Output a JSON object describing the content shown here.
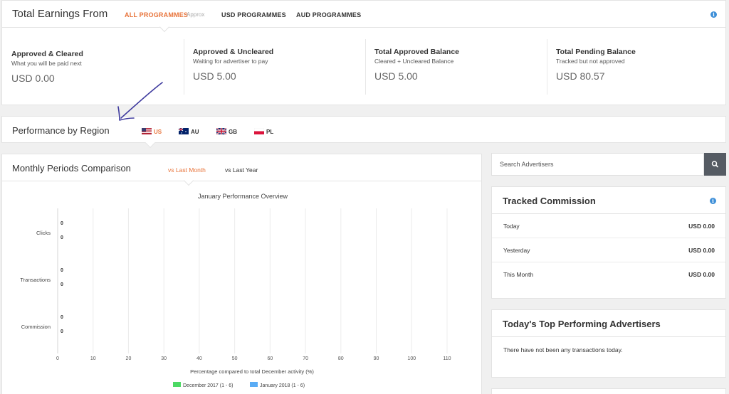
{
  "earnings": {
    "title": "Total Earnings From",
    "tabs": [
      "ALL PROGRAMMES",
      "USD PROGRAMMES",
      "AUD PROGRAMMES"
    ],
    "approx": "Approx",
    "info_icon": "info-icon",
    "columns": [
      {
        "label": "Approved & Cleared",
        "sub": "What you will be paid next",
        "amount": "USD 0.00"
      },
      {
        "label": "Approved & Uncleared",
        "sub": "Waiting for advertiser to pay",
        "amount": "USD 5.00"
      },
      {
        "label": "Total Approved Balance",
        "sub": "Cleared + Uncleared Balance",
        "amount": "USD 5.00"
      },
      {
        "label": "Total Pending Balance",
        "sub": "Tracked but not approved",
        "amount": "USD 80.57"
      }
    ]
  },
  "region": {
    "title": "Performance by Region",
    "flags": [
      {
        "code": "US",
        "icon": "us-flag-icon"
      },
      {
        "code": "AU",
        "icon": "au-flag-icon"
      },
      {
        "code": "GB",
        "icon": "gb-flag-icon"
      },
      {
        "code": "PL",
        "icon": "pl-flag-icon"
      }
    ]
  },
  "comparison": {
    "title": "Monthly Periods Comparison",
    "tabs": [
      "vs Last Month",
      "vs Last Year"
    ]
  },
  "chart_data": {
    "type": "bar",
    "orientation": "horizontal",
    "title": "January Performance Overview",
    "xlabel": "Percentage compared to total December activity (%)",
    "ylabel": "",
    "categories": [
      "Clicks",
      "Transactions",
      "Commission"
    ],
    "series": [
      {
        "name": "December 2017 (1 - 6)",
        "values": [
          0,
          0,
          0
        ],
        "color": "#4cd964"
      },
      {
        "name": "January 2018 (1 - 6)",
        "values": [
          0,
          0,
          0
        ],
        "color": "#5aacf5"
      }
    ],
    "xlim": [
      0,
      110
    ],
    "xticks": [
      0,
      10,
      20,
      30,
      40,
      50,
      60,
      70,
      80,
      90,
      100,
      110
    ],
    "grid": true,
    "legend": "bottom"
  },
  "search": {
    "placeholder": "Search Advertisers",
    "icon": "search-icon"
  },
  "tracked": {
    "title": "Tracked Commission",
    "info_icon": "info-icon",
    "rows": [
      {
        "label": "Today",
        "value": "USD 0.00"
      },
      {
        "label": "Yesterday",
        "value": "USD 0.00"
      },
      {
        "label": "This Month",
        "value": "USD 0.00"
      }
    ]
  },
  "top_advertisers": {
    "title": "Today's Top Performing Advertisers",
    "empty": "There have not been any transactions today."
  },
  "colors": {
    "accent": "#e8743b",
    "info": "#3d8fd8",
    "annotation": "#3e3a9e"
  }
}
